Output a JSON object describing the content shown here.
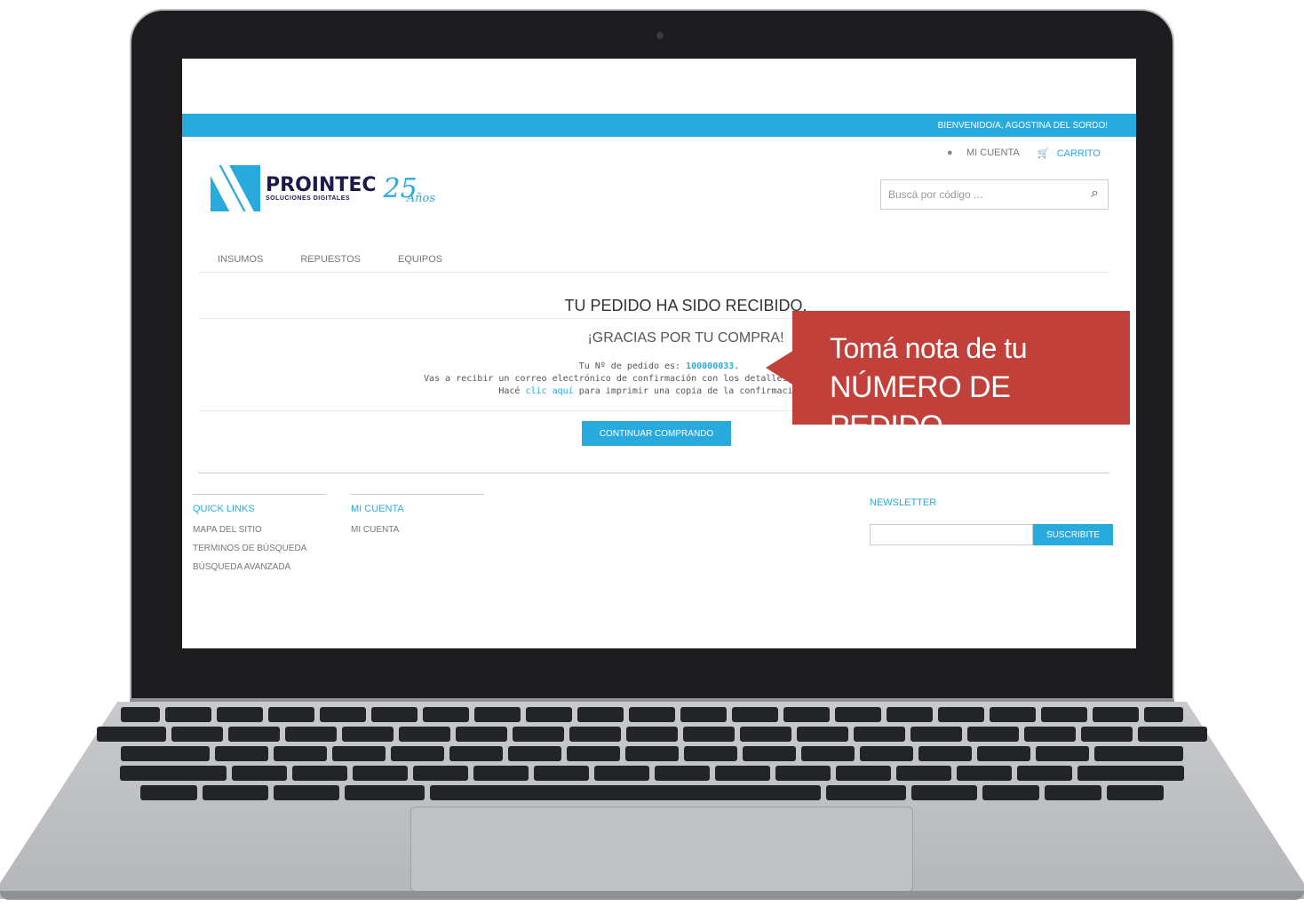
{
  "site": {
    "welcome": "BIENVENIDO/A, AGOSTINA DEL SORDO!",
    "account_link": "MI CUENTA",
    "cart_link": "CARRITO",
    "search_placeholder": "Buscá por código ...",
    "brand_name": "PROINTEC",
    "brand_tagline": "SOLUCIONES DIGITALES",
    "brand_years": "25",
    "brand_years_word": "Años",
    "nav": [
      "INSUMOS",
      "REPUESTOS",
      "EQUIPOS"
    ]
  },
  "confirmation": {
    "title": "TU PEDIDO HA SIDO RECIBIDO.",
    "thanks": "¡GRACIAS POR TU COMPRA!",
    "order_prefix": "Tu Nº de pedido es:",
    "order_number": "100000033",
    "email_line": "Vas a recibir un correo electrónico de confirmación con los detalles de tu pedido y un e",
    "print_pre": "Hacé",
    "print_link": "clic aquí",
    "print_post": "para imprimir una copia de la confirmación de",
    "continue_button": "CONTINUAR COMPRANDO"
  },
  "footer": {
    "quick_links_title": "QUICK LINKS",
    "quick_links": [
      "MAPA DEL SITIO",
      "TERMINOS DE BÚSQUEDA",
      "BÚSQUEDA AVANZADA"
    ],
    "account_title": "MI CUENTA",
    "account_links": [
      "MI CUENTA"
    ],
    "newsletter_title": "NEWSLETTER",
    "subscribe_button": "SUSCRIBITE"
  },
  "callout": {
    "line1": "Tomá nota de tu",
    "line2": "NÚMERO DE PEDIDO"
  },
  "colors": {
    "accent": "#29aadd",
    "callout": "#c2403a"
  }
}
